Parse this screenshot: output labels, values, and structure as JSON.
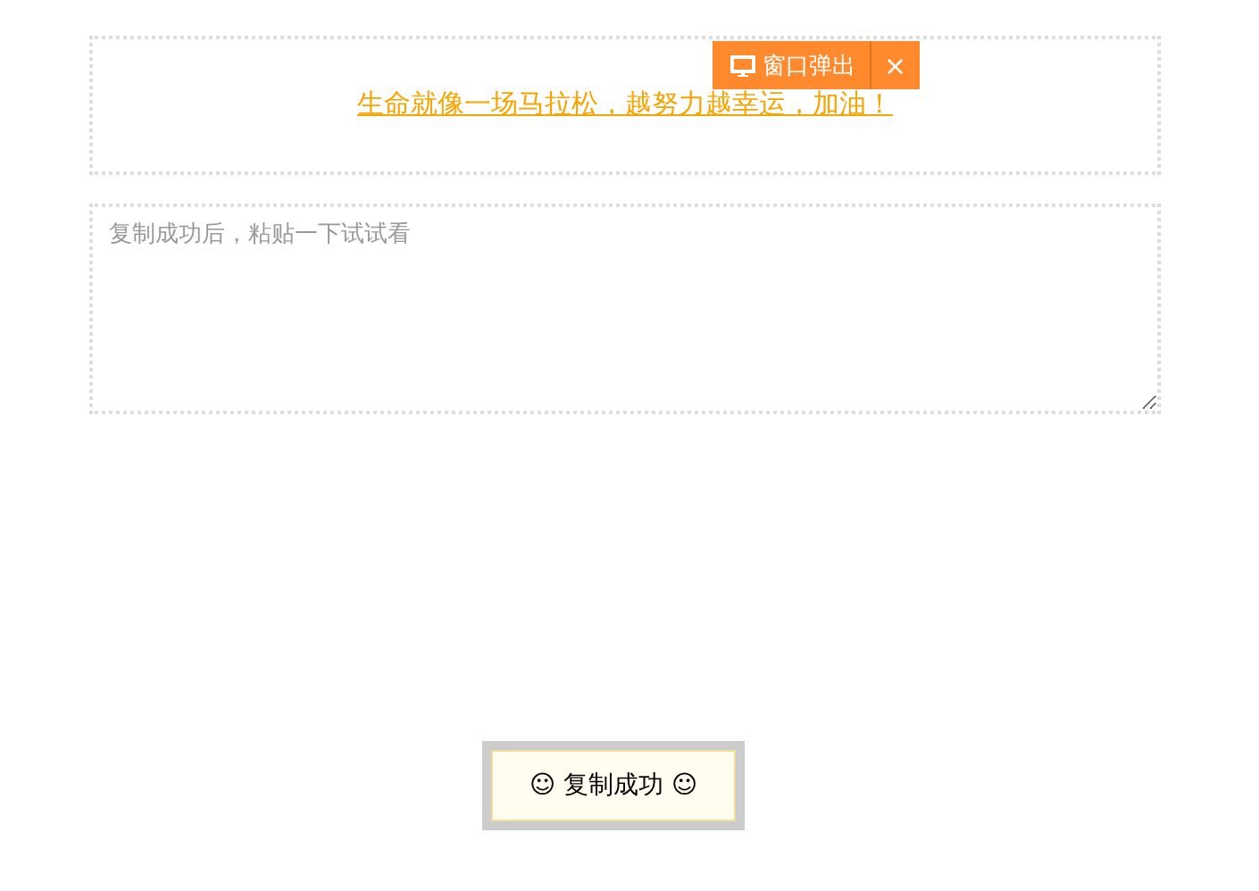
{
  "link": {
    "text": "生命就像一场马拉松，越努力越幸运，加油！"
  },
  "popup_button": {
    "label": "窗口弹出",
    "close": "×"
  },
  "textarea": {
    "placeholder": "复制成功后，粘贴一下试试看"
  },
  "toast": {
    "text": "☺ 复制成功 ☺"
  }
}
